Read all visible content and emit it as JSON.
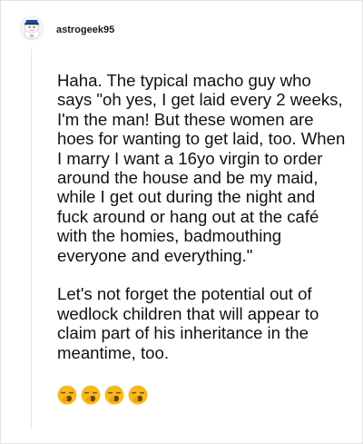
{
  "comment": {
    "username": "astrogeek95",
    "paragraphs": [
      "Haha. The typical macho guy who says \"oh yes, I get laid every 2 weeks, I'm the man! But these women are hoes for wanting to get laid, too. When I marry I want a 16yo virgin to order around the house and be my maid, while I get out during the night and fuck around or hang out at the café with the homies, badmouthing everyone and everything.\"",
      "Let's not forget the potential out of wedlock children that will appear to claim part of his inheritance in the meantime, too."
    ],
    "emojis": [
      "yawning-face",
      "yawning-face",
      "yawning-face",
      "yawning-face"
    ]
  },
  "colors": {
    "text": "#111111",
    "username": "#1a1a1b",
    "border": "#e3e3e3",
    "thread_line": "#e6e6e6",
    "emoji_face": "#f7b91c",
    "emoji_feature": "#6b3e12"
  }
}
